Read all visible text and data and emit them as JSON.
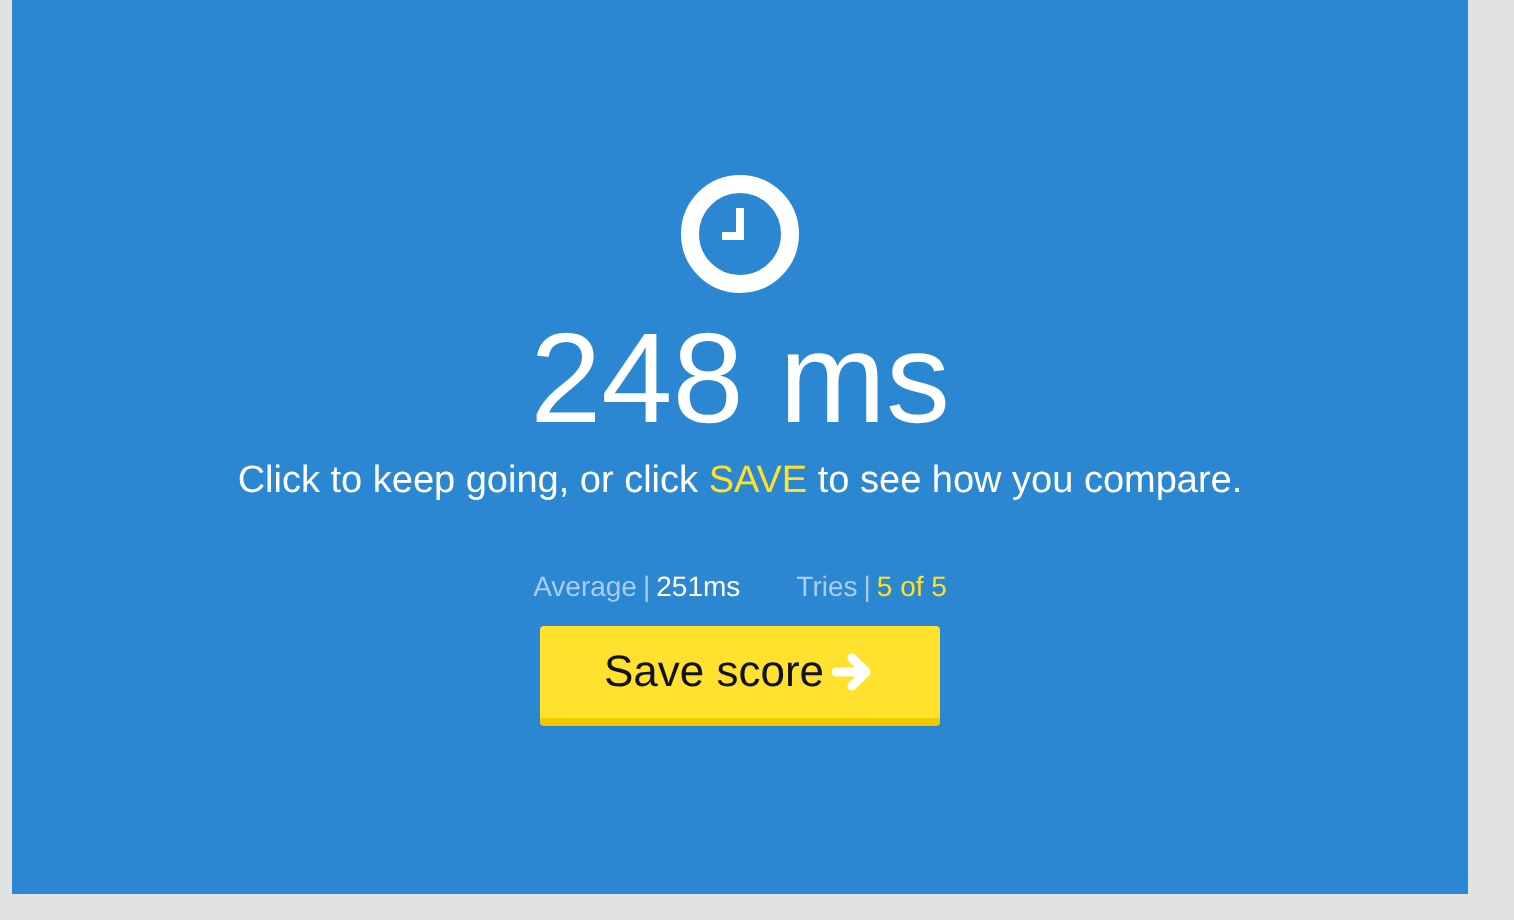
{
  "result": "248 ms",
  "message": {
    "before": "Click to keep going, or click ",
    "highlight": "SAVE",
    "after": " to see how you compare."
  },
  "stats": [
    {
      "label": "Average",
      "separator": "|",
      "value": "251ms",
      "kind": "plain"
    },
    {
      "label": "Tries",
      "separator": "|",
      "value": "5 of 5",
      "kind": "highlight"
    }
  ],
  "button": {
    "label": "Save score"
  }
}
